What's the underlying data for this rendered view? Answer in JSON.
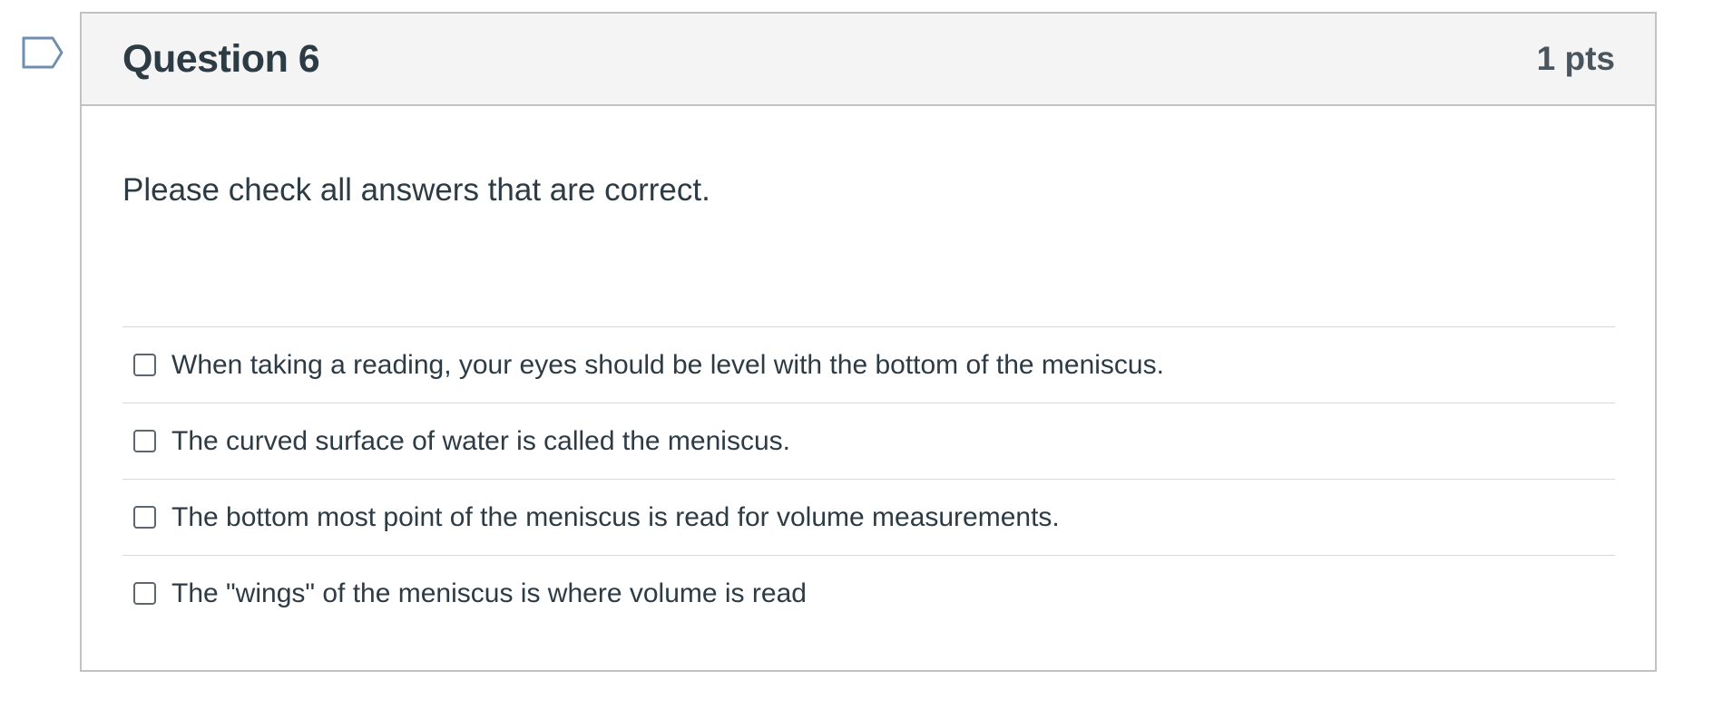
{
  "question": {
    "title": "Question 6",
    "points": "1 pts",
    "prompt": "Please check all answers that are correct.",
    "answers": [
      {
        "label": "When taking a reading, your eyes should be level with the bottom of the meniscus.",
        "checked": false
      },
      {
        "label": "The curved surface of water is called the meniscus.",
        "checked": false
      },
      {
        "label": "The bottom most point of the meniscus is read for volume measurements.",
        "checked": false
      },
      {
        "label": "The \"wings\" of the meniscus is where volume is read",
        "checked": false
      }
    ]
  },
  "flag": {
    "icon": "bookmark-flag-icon",
    "color": "#6f8fb0"
  }
}
